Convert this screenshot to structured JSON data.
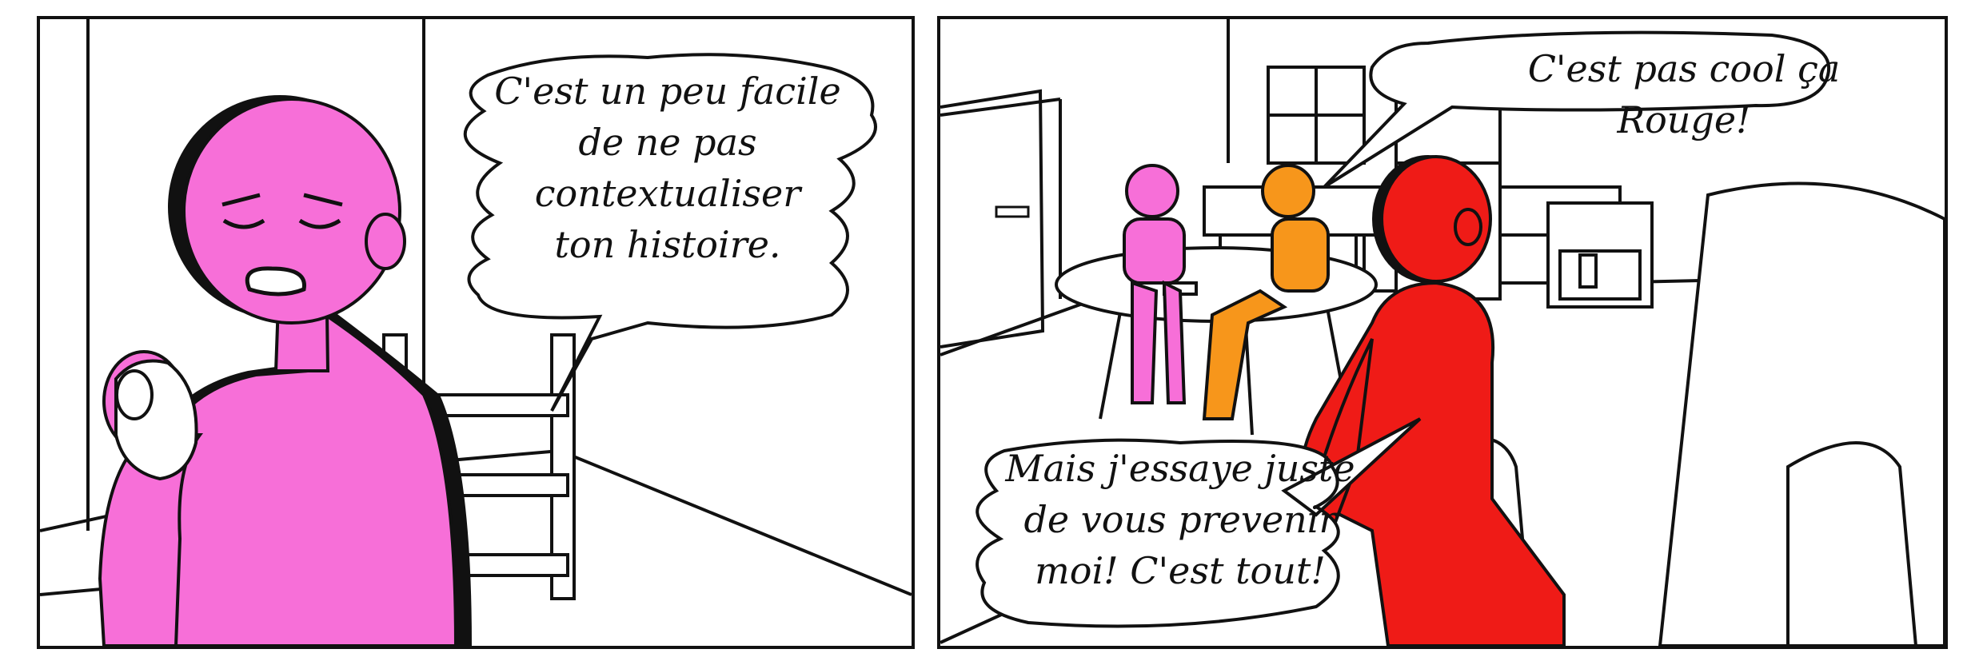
{
  "panels": [
    {
      "speech": "C'est un peu facile\nde ne pas\ncontextualiser\nton histoire."
    },
    {
      "speech_top": "C'est pas cool ça Rouge!",
      "speech_bottom": "Mais j'essaye juste\nde vous prevenir\nmoi! C'est tout!"
    }
  ],
  "colors": {
    "pink_character": "#f76fd8",
    "red_character": "#ef1b17",
    "orange_character": "#f7961b",
    "ink": "#111111",
    "paper": "#ffffff"
  }
}
